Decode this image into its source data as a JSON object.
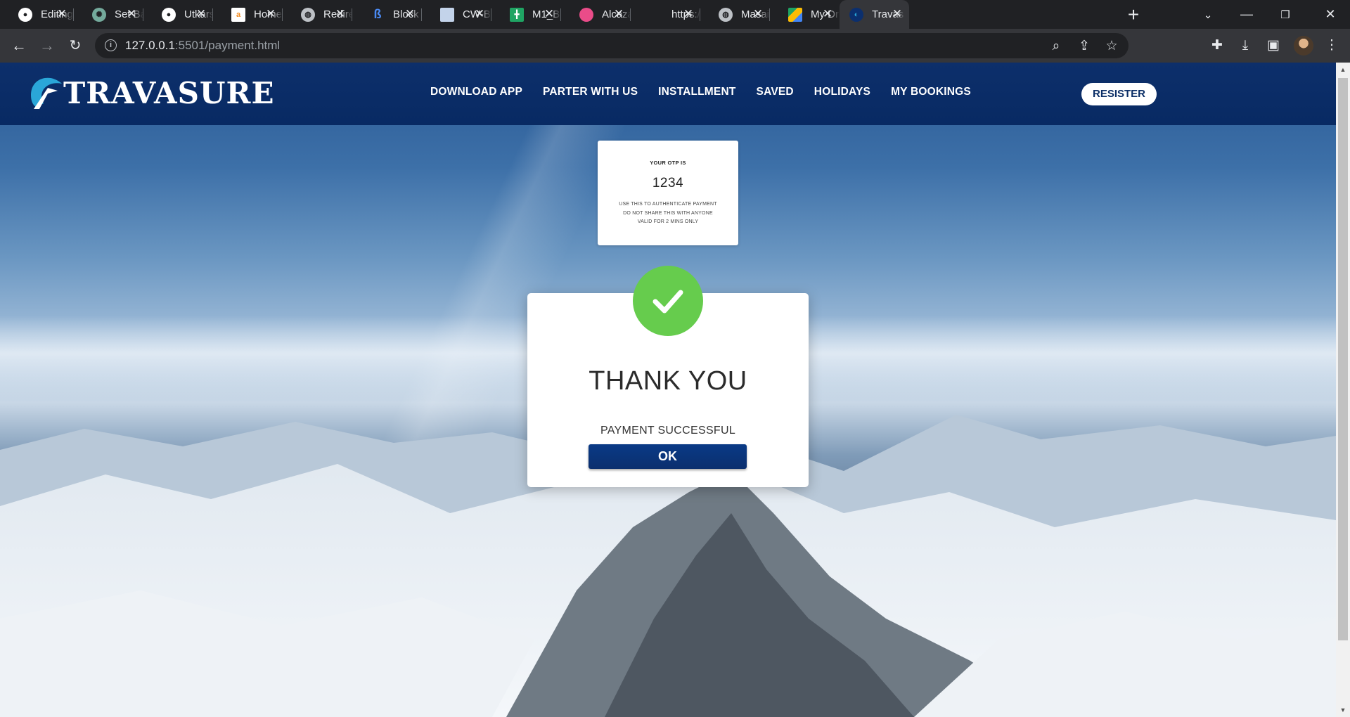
{
  "browser": {
    "tabs": [
      {
        "title": "Editing",
        "icon": "github-icon",
        "color": "#ffffff"
      },
      {
        "title": "Set Ba",
        "icon": "chatgpt-icon",
        "color": "#74aa9c"
      },
      {
        "title": "Utkarsh",
        "icon": "github-icon",
        "color": "#ffffff"
      },
      {
        "title": "Home",
        "icon": "page-icon",
        "color": "#f28b20"
      },
      {
        "title": "Redire",
        "icon": "globe-icon",
        "color": "#bdc1c6"
      },
      {
        "title": "Block",
        "icon": "block-icon",
        "color": "#4b8bf5"
      },
      {
        "title": "CW-B",
        "icon": "doc-icon",
        "color": "#c3d3ea"
      },
      {
        "title": "M1_B",
        "icon": "sheets-icon",
        "color": "#1fa463"
      },
      {
        "title": "Alcaza",
        "icon": "dribbble-icon",
        "color": "#ea4c89"
      },
      {
        "title": "https:/",
        "icon": "blank-icon",
        "color": "#202124"
      },
      {
        "title": "Masai",
        "icon": "globe-icon",
        "color": "#bdc1c6"
      },
      {
        "title": "My Dr",
        "icon": "drive-icon",
        "color": "#fbbc04"
      },
      {
        "title": "Travas",
        "icon": "travasure-icon",
        "color": "#2aa6d8"
      }
    ],
    "url_host": "127.0.0.1",
    "url_path": ":5501/payment.html"
  },
  "site": {
    "brand": "TRAVASURE",
    "nav": [
      "DOWNLOAD APP",
      "PARTER WITH US",
      "INSTALLMENT",
      "SAVED",
      "HOLIDAYS",
      "MY BOOKINGS"
    ],
    "register_label": "RESISTER"
  },
  "otp": {
    "label": "YOUR OTP IS",
    "code": "1234",
    "note_lines": [
      "USE THIS TO AUTHENTICATE PAYMENT",
      "DO NOT SHARE THIS WITH ANYONE",
      "VALID FOR 2 MINS ONLY"
    ]
  },
  "success": {
    "title": "THANK YOU",
    "message": "PAYMENT SUCCESSFUL",
    "button": "OK"
  },
  "colors": {
    "header_bg": "#082a63",
    "check_green": "#66cc4d",
    "ok_button": "#0b2f6e"
  }
}
